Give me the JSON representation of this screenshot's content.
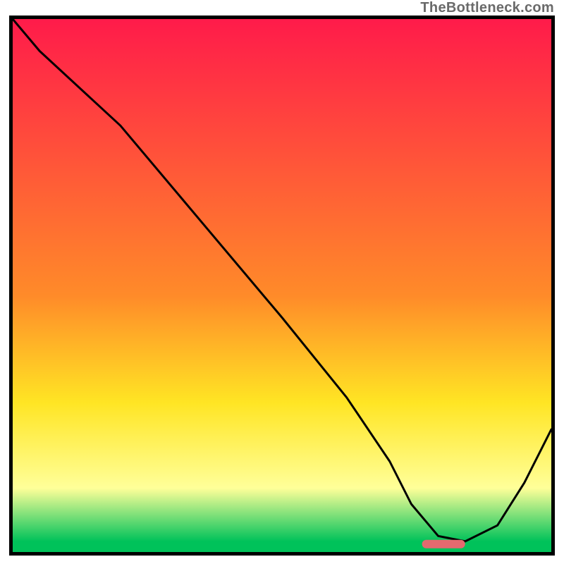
{
  "watermark": "TheBottleneck.com",
  "colors": {
    "top": "#ff1b4a",
    "midOrange": "#ff8b29",
    "yellow": "#ffe524",
    "paleYellow": "#ffff99",
    "green": "#00c25a",
    "grey": "#6a6a6a",
    "curve": "#000000",
    "marker": "#e46a6f"
  },
  "chart_data": {
    "type": "line",
    "title": "",
    "xlabel": "",
    "ylabel": "",
    "xlim": [
      0,
      100
    ],
    "ylim": [
      0,
      100
    ],
    "gradient_stops": [
      {
        "y": 0,
        "color": "#ff1b4a"
      },
      {
        "y": 52,
        "color": "#ff8b29"
      },
      {
        "y": 72,
        "color": "#ffe524"
      },
      {
        "y": 88,
        "color": "#ffff99"
      },
      {
        "y": 98,
        "color": "#00c25a"
      },
      {
        "y": 100,
        "color": "#00c25a"
      }
    ],
    "series": [
      {
        "name": "bottleneck-curve",
        "x": [
          0,
          5,
          20,
          35,
          50,
          62,
          70,
          74,
          79,
          84,
          90,
          95,
          100
        ],
        "y": [
          100,
          94,
          80,
          62,
          44,
          29,
          17,
          9,
          3,
          2,
          5,
          13,
          23
        ]
      }
    ],
    "marker": {
      "name": "optimal-range",
      "x_start": 76,
      "x_end": 84,
      "y": 1.5
    }
  }
}
